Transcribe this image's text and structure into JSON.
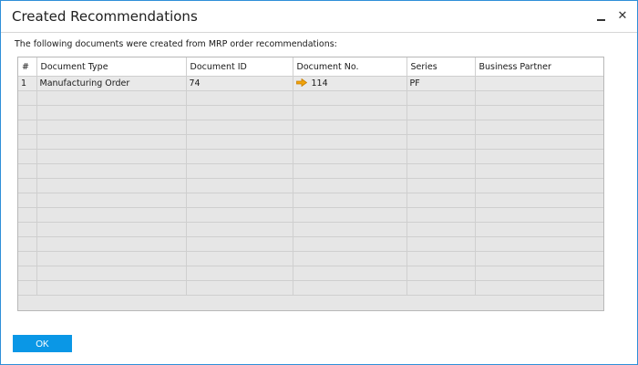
{
  "window": {
    "title": "Created Recommendations",
    "minimize_symbol": "",
    "close_symbol": "✕"
  },
  "info_text": "The following documents were created from MRP order recommendations:",
  "grid": {
    "columns": [
      "#",
      "Document Type",
      "Document ID",
      "Document No.",
      "Series",
      "Business Partner"
    ],
    "rows": [
      {
        "row_no": "1",
        "document_type": "Manufacturing Order",
        "document_id": "74",
        "document_no": "114",
        "series": "PF",
        "business_partner": ""
      }
    ],
    "empty_row_count": 14,
    "link_arrow_icon": "orange-link-arrow",
    "link_arrow_color": "#f0a30a"
  },
  "buttons": {
    "ok_label": "OK"
  },
  "colors": {
    "accent": "#0a97e6",
    "window_border": "#2f8fd8"
  }
}
